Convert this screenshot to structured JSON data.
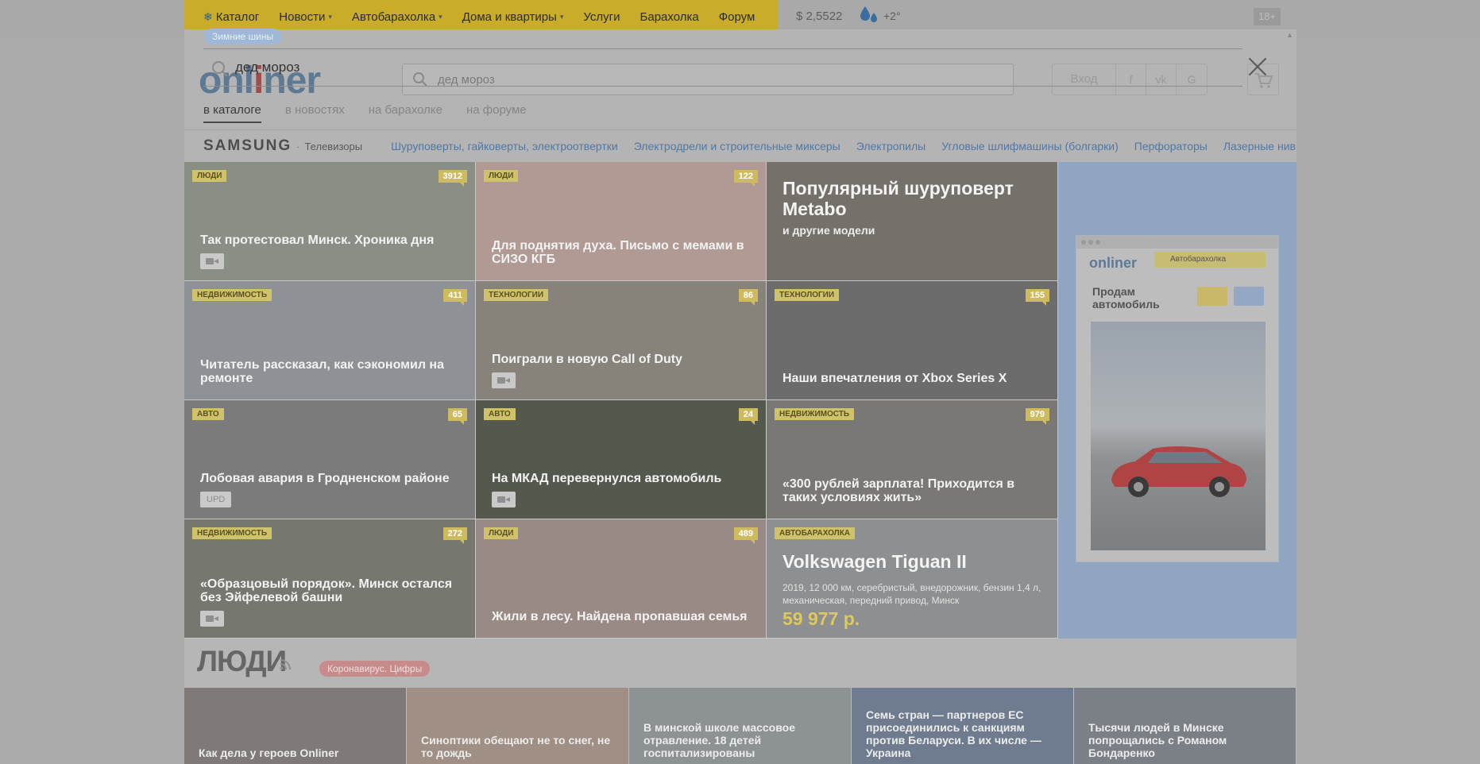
{
  "topnav": {
    "items": [
      {
        "label": "Каталог"
      },
      {
        "label": "Новости",
        "caret": true
      },
      {
        "label": "Автобарахолка",
        "caret": true
      },
      {
        "label": "Дома и квартиры",
        "caret": true
      },
      {
        "label": "Услуги"
      },
      {
        "label": "Барахолка"
      },
      {
        "label": "Форум"
      }
    ],
    "currency": "$ 2,5522",
    "temperature": "+2°",
    "age": "18+"
  },
  "header": {
    "logo_left": "onl",
    "logo_mid": "i",
    "logo_right": "ner",
    "bg_search_text": "дед мороз",
    "login_label": "Вход",
    "social": [
      "f",
      "vk",
      "G"
    ]
  },
  "search": {
    "tag": "Зимние шины",
    "query": "дед мороз",
    "tabs": [
      "в каталоге",
      "в новостях",
      "на барахолке",
      "на форуме"
    ],
    "active_tab": 0,
    "brand": "SAMSUNG",
    "brand_sub": "Телевизоры",
    "quick_links": [
      "Шуруповерты, гайковерты, электроотвертки",
      "Электродрели и строительные миксеры",
      "Электропилы",
      "Угловые шлифмашины (болгарки)",
      "Перфораторы",
      "Лазерные нив"
    ]
  },
  "tiles": [
    {
      "rubric": "Люди",
      "count": "3912",
      "title": "Так протестовал Минск. Хроника дня",
      "badge": "video",
      "bg": "#8a8f86"
    },
    {
      "rubric": "Люди",
      "count": "122",
      "title": "Для поднятия духа. Письмо с мемами в СИЗО КГБ",
      "badge": "",
      "bg": "#b09a93"
    },
    {
      "promo": true,
      "title": "Популярный шуруповерт Metabo",
      "subtitle": "и другие модели",
      "bg": "#75716a"
    },
    {
      "rubric": "Недвижимость",
      "count": "411",
      "title": "Читатель рассказал, как сэкономил на ремонте",
      "badge": "",
      "bg": "#8e9196"
    },
    {
      "rubric": "Технологии",
      "count": "86",
      "title": "Поиграли в новую Call of Duty",
      "badge": "video",
      "bg": "#87837b"
    },
    {
      "rubric": "Технологии",
      "count": "155",
      "title": "Наши впечатления от Xbox Series X",
      "badge": "",
      "bg": "#6c6c6c"
    },
    {
      "rubric": "Авто",
      "count": "65",
      "title": "Лобовая авария в Гродненском районе",
      "badge": "upd",
      "badge_text": "UPD",
      "bg": "#7b7b7b"
    },
    {
      "rubric": "Авто",
      "count": "24",
      "title": "На МКАД перевернулся автомобиль",
      "badge": "video",
      "bg": "#55584d"
    },
    {
      "rubric": "Недвижимость",
      "count": "979",
      "title": "«300 рублей зарплата! Приходится в таких условиях жить»",
      "badge": "",
      "bg": "#7a7874"
    },
    {
      "rubric": "Недвижимость",
      "count": "272",
      "title": "«Образцовый порядок». Минск остался без Эйфелевой башни",
      "badge": "video",
      "bg": "#76786f"
    },
    {
      "rubric": "Люди",
      "count": "489",
      "title": "Жили в лесу. Найдена пропавшая семья",
      "badge": "",
      "bg": "#9a8a86"
    },
    {
      "car": true,
      "rubric": "Автобарахолка",
      "title": "Volkswagen Tiguan II",
      "desc": "2019, 12 000 км, серебристый, внедорожник, бензин 1,4 л, механическая, передний привод, Минск",
      "price": "59 977 р.",
      "bg": "#8d8f91"
    }
  ],
  "ad": {
    "logo": "onliner",
    "tab": "Автобарахолка",
    "heading": "Продам автомобиль"
  },
  "people": {
    "title": "ЛЮДИ",
    "tag": "Коронавирус. Цифры"
  },
  "bottom_tiles": [
    {
      "title": "Как дела у героев Onliner",
      "bg": "#7f7a77"
    },
    {
      "title": "Синоптики обещают не то снег, не то дождь",
      "bg": "#9f8f84"
    },
    {
      "title": "В минской школе массовое отравление. 18 детей госпитализированы",
      "bg": "#8d9295"
    },
    {
      "title": "Семь стран — партнеров ЕС присоединились к санкциям против Беларуси. В их числе — Украина",
      "bg": "#6f7c90"
    },
    {
      "title": "Тысячи людей в Минске попрощались с Романом Бондаренко",
      "bg": "#7b8086"
    }
  ]
}
